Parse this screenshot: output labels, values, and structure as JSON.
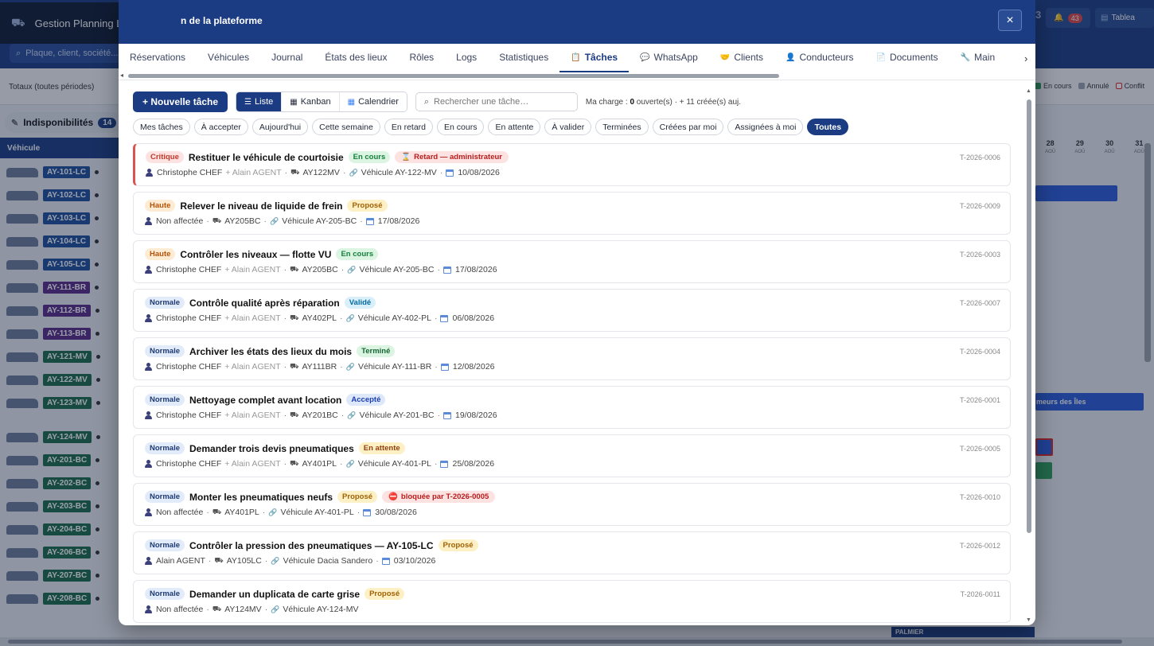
{
  "background": {
    "app_title": "Gestion Planning Lite",
    "search_placeholder": "Plaque, client, société...",
    "totals_label": "Totaux (toutes périodes)",
    "indispo_label": "Indisponibilités",
    "indispo_count": "14",
    "vehicle_header": "Véhicule",
    "top_right_number": "3",
    "notif_count": "43",
    "dashboard_label": "Tablea",
    "legend": [
      {
        "label": "En cours",
        "color": "#2e9e5b"
      },
      {
        "label": "Annulé",
        "color": "#9ca3af"
      },
      {
        "label": "Conflit",
        "color": "#dc2626"
      }
    ],
    "days": [
      {
        "num": "28",
        "mon": "AOÛ"
      },
      {
        "num": "29",
        "mon": "AOÛ"
      },
      {
        "num": "30",
        "mon": "AOÛ"
      },
      {
        "num": "31",
        "mon": "AOÛ"
      }
    ],
    "right_label": "meurs des Îles",
    "bottom_label": "PALMIER",
    "vehicles": [
      {
        "plate": "AY-101-LC",
        "color": "#1e4f9c"
      },
      {
        "plate": "AY-102-LC",
        "color": "#1e4f9c"
      },
      {
        "plate": "AY-103-LC",
        "color": "#1e4f9c"
      },
      {
        "plate": "AY-104-LC",
        "color": "#1e4f9c"
      },
      {
        "plate": "AY-105-LC",
        "color": "#1e4f9c"
      },
      {
        "plate": "AY-111-BR",
        "color": "#5b2a86"
      },
      {
        "plate": "AY-112-BR",
        "color": "#5b2a86"
      },
      {
        "plate": "AY-113-BR",
        "color": "#5b2a86"
      },
      {
        "plate": "AY-121-MV",
        "color": "#1b6b4a"
      },
      {
        "plate": "AY-122-MV",
        "color": "#1b6b4a"
      },
      {
        "plate": "AY-123-MV",
        "color": "#1b6b4a"
      },
      {
        "plate": "AY-124-MV",
        "color": "#1b6b4a"
      },
      {
        "plate": "AY-201-BC",
        "color": "#1b6b4a"
      },
      {
        "plate": "AY-202-BC",
        "color": "#1b6b4a"
      },
      {
        "plate": "AY-203-BC",
        "color": "#1b6b4a"
      },
      {
        "plate": "AY-204-BC",
        "color": "#1b6b4a"
      },
      {
        "plate": "AY-206-BC",
        "color": "#1b6b4a"
      },
      {
        "plate": "AY-207-BC",
        "color": "#1b6b4a"
      },
      {
        "plate": "AY-208-BC",
        "color": "#1b6b4a"
      }
    ]
  },
  "modal": {
    "title": "n de la plateforme",
    "close_label": "×",
    "tabs": [
      {
        "label": "Réservations",
        "icon": ""
      },
      {
        "label": "Véhicules",
        "icon": ""
      },
      {
        "label": "Journal",
        "icon": ""
      },
      {
        "label": "États des lieux",
        "icon": ""
      },
      {
        "label": "Rôles",
        "icon": ""
      },
      {
        "label": "Logs",
        "icon": ""
      },
      {
        "label": "Statistiques",
        "icon": ""
      },
      {
        "label": "Tâches",
        "icon": "clipboard-icon",
        "active": true
      },
      {
        "label": "WhatsApp",
        "icon": "chat-icon"
      },
      {
        "label": "Clients",
        "icon": "handshake-icon"
      },
      {
        "label": "Conducteurs",
        "icon": "person-icon"
      },
      {
        "label": "Documents",
        "icon": "document-icon"
      },
      {
        "label": "Main",
        "icon": "wrench-icon"
      }
    ],
    "toolbar": {
      "new_task_label": "+ Nouvelle tâche",
      "view_list_label": "Liste",
      "view_kanban_label": "Kanban",
      "view_calendar_label": "Calendrier",
      "search_placeholder": "Rechercher une tâche…",
      "charge_prefix": "Ma charge :",
      "charge_open_count": "0",
      "charge_suffix": "ouverte(s) · + 11 créée(s) auj."
    },
    "filters": [
      {
        "label": "Mes tâches"
      },
      {
        "label": "À accepter"
      },
      {
        "label": "Aujourd'hui"
      },
      {
        "label": "Cette semaine"
      },
      {
        "label": "En retard"
      },
      {
        "label": "En cours"
      },
      {
        "label": "En attente"
      },
      {
        "label": "À valider"
      },
      {
        "label": "Terminées"
      },
      {
        "label": "Créées par moi"
      },
      {
        "label": "Assignées à moi"
      },
      {
        "label": "Toutes",
        "active": true
      }
    ],
    "tasks": [
      {
        "priority": "Critique",
        "pri_class": "pri-critique",
        "title": "Restituer le véhicule de courtoisie",
        "status": "En cours",
        "st_class": "st-encours",
        "alert": "Retard — administrateur",
        "alert_icon": "hourglass-icon",
        "assignee": "Christophe CHEF",
        "coassignee": "+ Alain AGENT",
        "vehicle_code": "AY122MV",
        "linked": "Véhicule AY-122-MV",
        "date": "10/08/2026",
        "ref": "T-2026-0006",
        "critical": true
      },
      {
        "priority": "Haute",
        "pri_class": "pri-haute",
        "title": "Relever le niveau de liquide de frein",
        "status": "Proposé",
        "st_class": "st-propose",
        "alert": "",
        "assignee": "Non affectée",
        "coassignee": "",
        "vehicle_code": "AY205BC",
        "linked": "Véhicule AY-205-BC",
        "date": "17/08/2026",
        "ref": "T-2026-0009"
      },
      {
        "priority": "Haute",
        "pri_class": "pri-haute",
        "title": "Contrôler les niveaux — flotte VU",
        "status": "En cours",
        "st_class": "st-encours",
        "alert": "",
        "assignee": "Christophe CHEF",
        "coassignee": "+ Alain AGENT",
        "vehicle_code": "AY205BC",
        "linked": "Véhicule AY-205-BC",
        "date": "17/08/2026",
        "ref": "T-2026-0003"
      },
      {
        "priority": "Normale",
        "pri_class": "pri-normale",
        "title": "Contrôle qualité après réparation",
        "status": "Validé",
        "st_class": "st-valide",
        "alert": "",
        "assignee": "Christophe CHEF",
        "coassignee": "+ Alain AGENT",
        "vehicle_code": "AY402PL",
        "linked": "Véhicule AY-402-PL",
        "date": "06/08/2026",
        "ref": "T-2026-0007"
      },
      {
        "priority": "Normale",
        "pri_class": "pri-normale",
        "title": "Archiver les états des lieux du mois",
        "status": "Terminé",
        "st_class": "st-termine",
        "alert": "",
        "assignee": "Christophe CHEF",
        "coassignee": "+ Alain AGENT",
        "vehicle_code": "AY111BR",
        "linked": "Véhicule AY-111-BR",
        "date": "12/08/2026",
        "ref": "T-2026-0004"
      },
      {
        "priority": "Normale",
        "pri_class": "pri-normale",
        "title": "Nettoyage complet avant location",
        "status": "Accepté",
        "st_class": "st-accepte",
        "alert": "",
        "assignee": "Christophe CHEF",
        "coassignee": "+ Alain AGENT",
        "vehicle_code": "AY201BC",
        "linked": "Véhicule AY-201-BC",
        "date": "19/08/2026",
        "ref": "T-2026-0001"
      },
      {
        "priority": "Normale",
        "pri_class": "pri-normale",
        "title": "Demander trois devis pneumatiques",
        "status": "En attente",
        "st_class": "st-attente",
        "alert": "",
        "assignee": "Christophe CHEF",
        "coassignee": "+ Alain AGENT",
        "vehicle_code": "AY401PL",
        "linked": "Véhicule AY-401-PL",
        "date": "25/08/2026",
        "ref": "T-2026-0005"
      },
      {
        "priority": "Normale",
        "pri_class": "pri-normale",
        "title": "Monter les pneumatiques neufs",
        "status": "Proposé",
        "st_class": "st-propose",
        "alert": "bloquée par T-2026-0005",
        "alert_icon": "block-icon",
        "assignee": "Non affectée",
        "coassignee": "",
        "vehicle_code": "AY401PL",
        "linked": "Véhicule AY-401-PL",
        "date": "30/08/2026",
        "ref": "T-2026-0010"
      },
      {
        "priority": "Normale",
        "pri_class": "pri-normale",
        "title": "Contrôler la pression des pneumatiques — AY-105-LC",
        "status": "Proposé",
        "st_class": "st-propose",
        "alert": "",
        "assignee": "Alain AGENT",
        "coassignee": "",
        "vehicle_code": "AY105LC",
        "linked": "Véhicule Dacia Sandero",
        "date": "03/10/2026",
        "ref": "T-2026-0012"
      },
      {
        "priority": "Normale",
        "pri_class": "pri-normale",
        "title": "Demander un duplicata de carte grise",
        "status": "Proposé",
        "st_class": "st-propose",
        "alert": "",
        "assignee": "Non affectée",
        "coassignee": "",
        "vehicle_code": "AY124MV",
        "linked": "Véhicule AY-124-MV",
        "date": "",
        "ref": "T-2026-0011"
      }
    ]
  }
}
